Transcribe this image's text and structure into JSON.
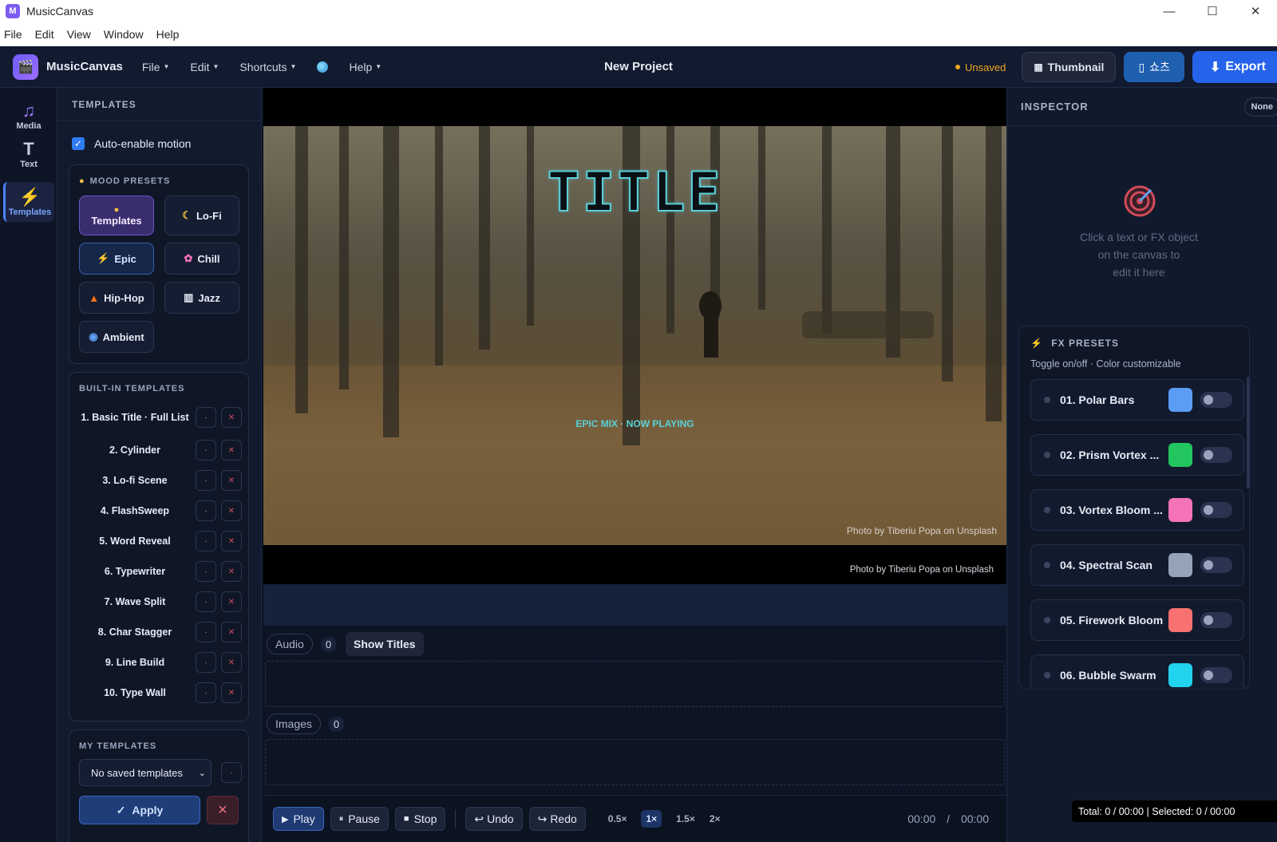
{
  "os": {
    "app_icon_letter": "M",
    "title": "MusicCanvas",
    "controls": [
      "—",
      "☐",
      "✕"
    ],
    "menu": [
      "File",
      "Edit",
      "View",
      "Window",
      "Help"
    ]
  },
  "header": {
    "app_name": "MusicCanvas",
    "menus": [
      "File",
      "Edit",
      "Shortcuts",
      "Help"
    ],
    "project_title": "New Project",
    "status": "Unsaved",
    "thumbnail_label": "Thumbnail",
    "shorts_label": "쇼츠",
    "export_label": "Export"
  },
  "rail": {
    "items": [
      {
        "icon": "♫",
        "label": "Media"
      },
      {
        "icon": "T",
        "label": "Text"
      },
      {
        "icon": "⚡",
        "label": "Templates"
      }
    ]
  },
  "templates_panel": {
    "heading": "TEMPLATES",
    "auto_motion_label": "Auto-enable motion",
    "mood_title": "MOOD PRESETS",
    "moods": [
      "Templates",
      "Lo-Fi",
      "Epic",
      "Chill",
      "Hip-Hop",
      "Jazz",
      "Ambient"
    ],
    "builtin_title": "BUILT-IN TEMPLATES",
    "builtin": [
      "1. Basic Title · Full List",
      "2. Cylinder",
      "3. Lo-fi Scene",
      "4. FlashSweep",
      "5. Word Reveal",
      "6. Typewriter",
      "7. Wave Split",
      "8. Char Stagger",
      "9. Line Build",
      "10. Type Wall"
    ],
    "my_title": "MY TEMPLATES",
    "my_select": "No saved templates",
    "apply_label": "Apply",
    "cancel_label": "✕"
  },
  "canvas": {
    "title_text": "TITLE",
    "now_playing": "EPIC MIX · NOW PLAYING",
    "credit_inner": "Photo by Tiberiu Popa on Unsplash",
    "credit_outer": "Photo by Tiberiu Popa on Unsplash"
  },
  "tracks": {
    "audio_label": "Audio",
    "audio_count": "0",
    "show_titles": "Show Titles",
    "images_label": "Images",
    "images_count": "0"
  },
  "transport": {
    "play": "Play",
    "pause": "Pause",
    "stop": "Stop",
    "undo": "Undo",
    "redo": "Redo",
    "speeds": [
      "0.5×",
      "1×",
      "1.5×",
      "2×"
    ],
    "active_speed": "1×",
    "time_current": "00:00",
    "time_sep": "/",
    "time_total": "00:00"
  },
  "inspector": {
    "heading": "INSPECTOR",
    "selection": "None",
    "hint_line1": "Click a text or FX object",
    "hint_line2": "on the canvas to",
    "hint_line3": "edit it here",
    "fx_title": "FX PRESETS",
    "fx_subtitle": "Toggle on/off · Color customizable",
    "fx_presets": [
      {
        "name": "01. Polar Bars",
        "color": "#5b9cf5"
      },
      {
        "name": "02. Prism Vortex ...",
        "color": "#22c55e"
      },
      {
        "name": "03. Vortex Bloom ...",
        "color": "#f472b6"
      },
      {
        "name": "04. Spectral Scan",
        "color": "#94a3b8"
      },
      {
        "name": "05. Firework Bloom",
        "color": "#f87171"
      },
      {
        "name": "06. Bubble Swarm",
        "color": "#22d3ee"
      }
    ]
  },
  "status_bar": {
    "totals": "Total: 0 / 00:00 | Selected: 0 / 00:00"
  }
}
